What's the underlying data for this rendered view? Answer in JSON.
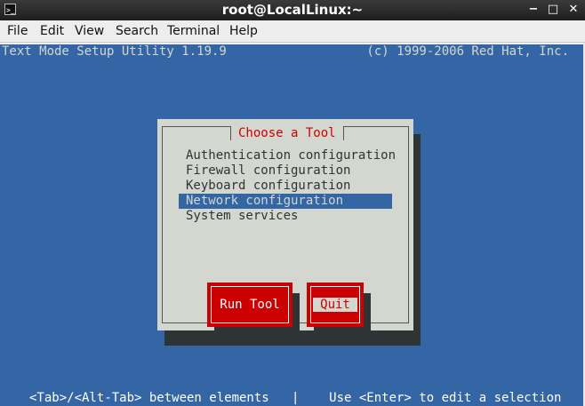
{
  "window": {
    "title": "root@LocalLinux:~",
    "icon": "terminal-icon",
    "controls": [
      "minimize-icon",
      "maximize-icon",
      "close-icon"
    ]
  },
  "menubar": {
    "items": [
      "File",
      "Edit",
      "View",
      "Search",
      "Terminal",
      "Help"
    ]
  },
  "terminal": {
    "header_left": "Text Mode Setup Utility 1.19.9",
    "header_right": "(c) 1999-2006 Red Hat, Inc.",
    "background_color": "#3465a4",
    "dialog": {
      "title": "Choose a Tool",
      "items": [
        "Authentication configuration",
        "Firewall configuration",
        "Keyboard configuration",
        "Network configuration",
        "System services"
      ],
      "selected_item": "Network configuration",
      "buttons": {
        "run_tool": "Run Tool",
        "quit": "Quit"
      },
      "focused_button": "Quit",
      "button_color": "#cc0000"
    },
    "status_line": "<Tab>/<Alt-Tab> between elements   |    Use <Enter> to edit a selection"
  }
}
